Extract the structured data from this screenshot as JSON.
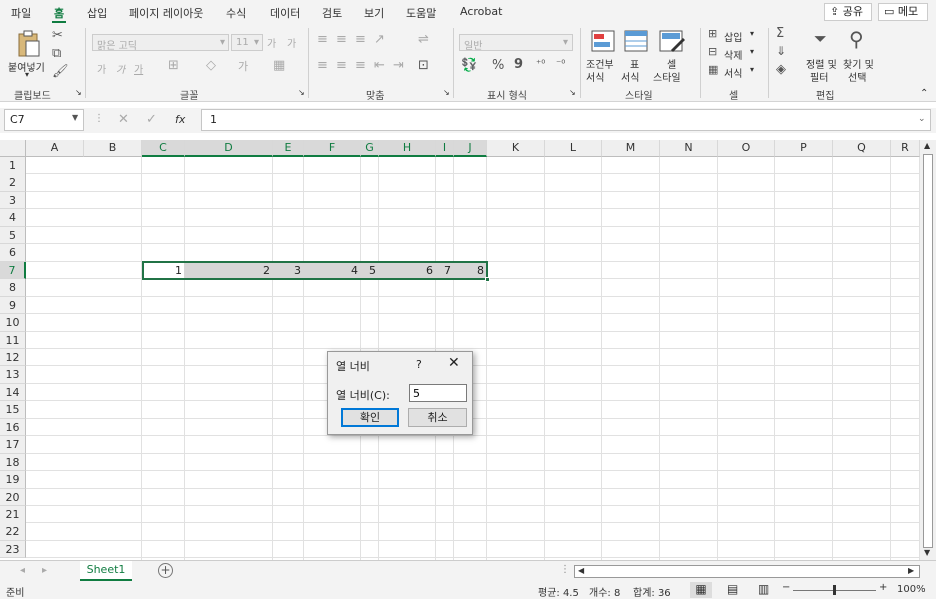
{
  "menu": {
    "tabs": [
      "파일",
      "홈",
      "삽입",
      "페이지 레이아웃",
      "수식",
      "데이터",
      "검토",
      "보기",
      "도움말",
      "Acrobat"
    ],
    "share_label": "공유",
    "memo_label": "메모"
  },
  "ribbon": {
    "clipboard": {
      "paste_label": "붙여넣기",
      "group_label": "클립보드"
    },
    "font": {
      "font_name": "맑은 고딕",
      "font_size": "11",
      "bold": "가",
      "italic": "가",
      "underline": "가",
      "grow": "가",
      "shrink": "가",
      "group_label": "글꼴"
    },
    "align": {
      "group_label": "맞춤"
    },
    "number": {
      "format": "일반",
      "percent": "%",
      "comma": "9",
      "group_label": "표시 형식"
    },
    "styles": {
      "cond_line1": "조건부",
      "cond_line2": "서식",
      "table_line1": "표",
      "table_line2": "서식",
      "cell_line1": "셀",
      "cell_line2": "스타일",
      "group_label": "스타일"
    },
    "cells": {
      "insert": "삽입",
      "delete": "삭제",
      "format": "서식",
      "group_label": "셀"
    },
    "editing": {
      "sort_line1": "정렬 및",
      "sort_line2": "필터",
      "find_line1": "찾기 및",
      "find_line2": "선택",
      "group_label": "편집"
    }
  },
  "formula_bar": {
    "name_box": "C7",
    "fx": "fx",
    "formula": "1"
  },
  "sheet": {
    "columns": [
      "A",
      "B",
      "C",
      "D",
      "E",
      "F",
      "G",
      "H",
      "I",
      "J",
      "K",
      "L",
      "M",
      "N",
      "O",
      "P",
      "Q",
      "R"
    ],
    "rows": [
      "1",
      "2",
      "3",
      "4",
      "5",
      "6",
      "7",
      "8",
      "9",
      "10",
      "11",
      "12",
      "13",
      "14",
      "15",
      "16",
      "17",
      "18",
      "19",
      "20",
      "21",
      "22",
      "23"
    ],
    "row7_values": [
      "1",
      "2",
      "3",
      "4",
      "5",
      "6",
      "7",
      "8"
    ]
  },
  "tabs": {
    "sheet_name": "Sheet1"
  },
  "status": {
    "ready": "준비",
    "average": "평균: 4.5",
    "count": "개수: 8",
    "sum": "합계: 36",
    "zoom": "100%"
  },
  "dialog": {
    "title": "열 너비",
    "help": "?",
    "close": "✕",
    "label": "열 너비(C):",
    "value": "5",
    "ok": "확인",
    "cancel": "취소"
  }
}
